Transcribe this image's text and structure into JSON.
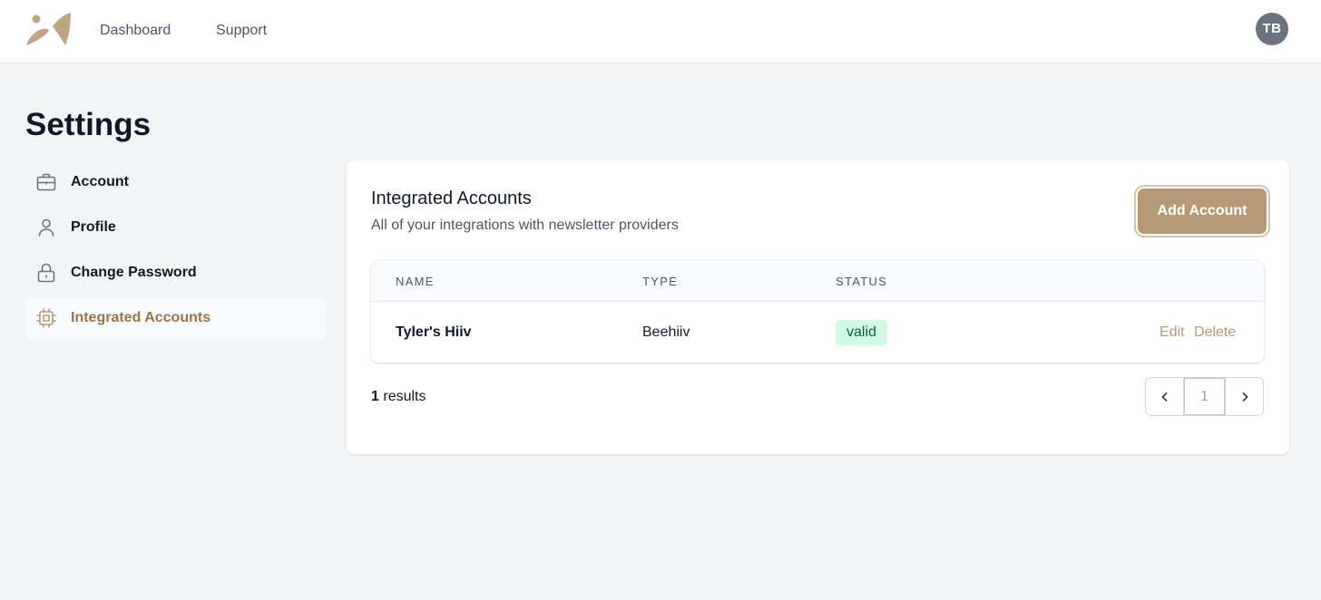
{
  "topbar": {
    "nav": [
      {
        "label": "Dashboard"
      },
      {
        "label": "Support"
      }
    ],
    "avatar_initials": "TB"
  },
  "page": {
    "title": "Settings"
  },
  "sidebar": {
    "items": [
      {
        "label": "Account",
        "icon": "briefcase-icon",
        "active": false
      },
      {
        "label": "Profile",
        "icon": "user-icon",
        "active": false
      },
      {
        "label": "Change Password",
        "icon": "lock-icon",
        "active": false
      },
      {
        "label": "Integrated Accounts",
        "icon": "chip-icon",
        "active": true
      }
    ]
  },
  "card": {
    "title": "Integrated Accounts",
    "subtitle": "All of your integrations with newsletter providers",
    "add_button_label": "Add Account"
  },
  "table": {
    "columns": [
      "NAME",
      "TYPE",
      "STATUS"
    ],
    "rows": [
      {
        "name": "Tyler's Hiiv",
        "type": "Beehiiv",
        "status": "valid",
        "edit_label": "Edit",
        "delete_label": "Delete"
      }
    ]
  },
  "footer": {
    "results_count": "1",
    "results_label": "results",
    "current_page": "1"
  },
  "colors": {
    "accent": "#b69a77",
    "accent_text": "#9a7548",
    "status_valid_bg": "#d1fae5",
    "status_valid_text": "#065f46"
  }
}
